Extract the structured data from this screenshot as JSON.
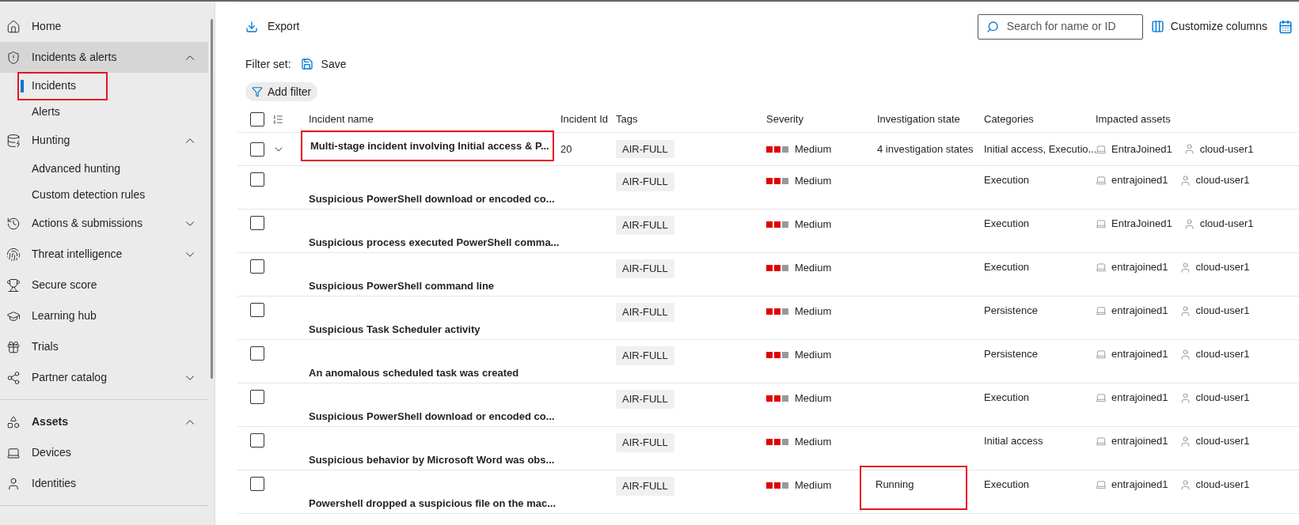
{
  "nav": {
    "sections": [
      {
        "items": [
          {
            "label": "Home",
            "selected": false
          },
          {
            "label": "Incidents & alerts",
            "selected": true,
            "expanded": true,
            "children": [
              {
                "label": "Incidents",
                "selected": true,
                "highlighted": true
              },
              {
                "label": "Alerts",
                "selected": false,
                "highlighted": false
              }
            ]
          },
          {
            "label": "Hunting",
            "selected": false,
            "expanded": true,
            "children": [
              {
                "label": "Advanced hunting",
                "selected": false,
                "highlighted": false
              },
              {
                "label": "Custom detection rules",
                "selected": false,
                "highlighted": false
              }
            ]
          },
          {
            "label": "Actions & submissions",
            "selected": false,
            "expanded": false
          },
          {
            "label": "Threat intelligence",
            "selected": false,
            "expanded": false
          },
          {
            "label": "Secure score",
            "selected": false
          },
          {
            "label": "Learning hub",
            "selected": false
          },
          {
            "label": "Trials",
            "selected": false
          },
          {
            "label": "Partner catalog",
            "selected": false,
            "expanded": false
          }
        ]
      },
      {
        "items": [
          {
            "label": "Assets",
            "selected": false,
            "expanded": true
          },
          {
            "label": "Devices",
            "selected": false
          },
          {
            "label": "Identities",
            "selected": false
          }
        ]
      }
    ]
  },
  "toolbar": {
    "export": "Export",
    "search_placeholder": "Search for name or ID",
    "customize_columns": "Customize columns"
  },
  "filters": {
    "filter_set": "Filter set:",
    "save": "Save",
    "add_filter": "Add filter"
  },
  "table": {
    "all_checked": false,
    "columns": [
      "Incident name",
      "Incident Id",
      "Tags",
      "Severity",
      "Investigation state",
      "Categories",
      "Impacted assets"
    ],
    "rows": [
      {
        "kind": "incident",
        "expanded": false,
        "checked": false,
        "name": "Multi-stage incident involving Initial access & P...",
        "name_highlighted": true,
        "id": "20",
        "tag": "AIR-FULL",
        "level": 0.67,
        "severity": "Medium",
        "investigation_state": "4 investigation states",
        "state_highlighted": false,
        "categories": "Initial access, Executio...",
        "device": "EntraJoined1",
        "user": "cloud-user1"
      },
      {
        "kind": "alert",
        "checked": false,
        "name": "Suspicious PowerShell download or encoded co...",
        "name_highlighted": false,
        "tag": "AIR-FULL",
        "level": 0.67,
        "severity": "Medium",
        "categories": "Execution",
        "device": "entrajoined1",
        "user": "cloud-user1"
      },
      {
        "kind": "alert",
        "checked": false,
        "name": "Suspicious process executed PowerShell comma...",
        "name_highlighted": false,
        "tag": "AIR-FULL",
        "level": 0.67,
        "severity": "Medium",
        "categories": "Execution",
        "device": "EntraJoined1",
        "user": "cloud-user1"
      },
      {
        "kind": "alert",
        "checked": false,
        "name": "Suspicious PowerShell command line",
        "name_highlighted": false,
        "tag": "AIR-FULL",
        "level": 0.67,
        "severity": "Medium",
        "categories": "Execution",
        "device": "entrajoined1",
        "user": "cloud-user1"
      },
      {
        "kind": "alert",
        "checked": false,
        "name": "Suspicious Task Scheduler activity",
        "name_highlighted": false,
        "tag": "AIR-FULL",
        "level": 0.67,
        "severity": "Medium",
        "categories": "Persistence",
        "device": "entrajoined1",
        "user": "cloud-user1"
      },
      {
        "kind": "alert",
        "checked": false,
        "name": "An anomalous scheduled task was created",
        "name_highlighted": false,
        "tag": "AIR-FULL",
        "level": 0.67,
        "severity": "Medium",
        "categories": "Persistence",
        "device": "entrajoined1",
        "user": "cloud-user1"
      },
      {
        "kind": "alert",
        "checked": false,
        "name": "Suspicious PowerShell download or encoded co...",
        "name_highlighted": false,
        "tag": "AIR-FULL",
        "level": 0.67,
        "severity": "Medium",
        "categories": "Execution",
        "device": "entrajoined1",
        "user": "cloud-user1"
      },
      {
        "kind": "alert",
        "checked": false,
        "name": "Suspicious behavior by Microsoft Word was obs...",
        "name_highlighted": false,
        "tag": "AIR-FULL",
        "level": 0.67,
        "severity": "Medium",
        "categories": "Initial access",
        "device": "entrajoined1",
        "user": "cloud-user1"
      },
      {
        "kind": "alert",
        "checked": false,
        "name": "Powershell dropped a suspicious file on the mac...",
        "name_highlighted": false,
        "tag": "AIR-FULL",
        "level": 0.67,
        "severity": "Medium",
        "investigation_state": "Running",
        "state_highlighted": true,
        "categories": "Execution",
        "device": "entrajoined1",
        "user": "cloud-user1"
      }
    ]
  }
}
